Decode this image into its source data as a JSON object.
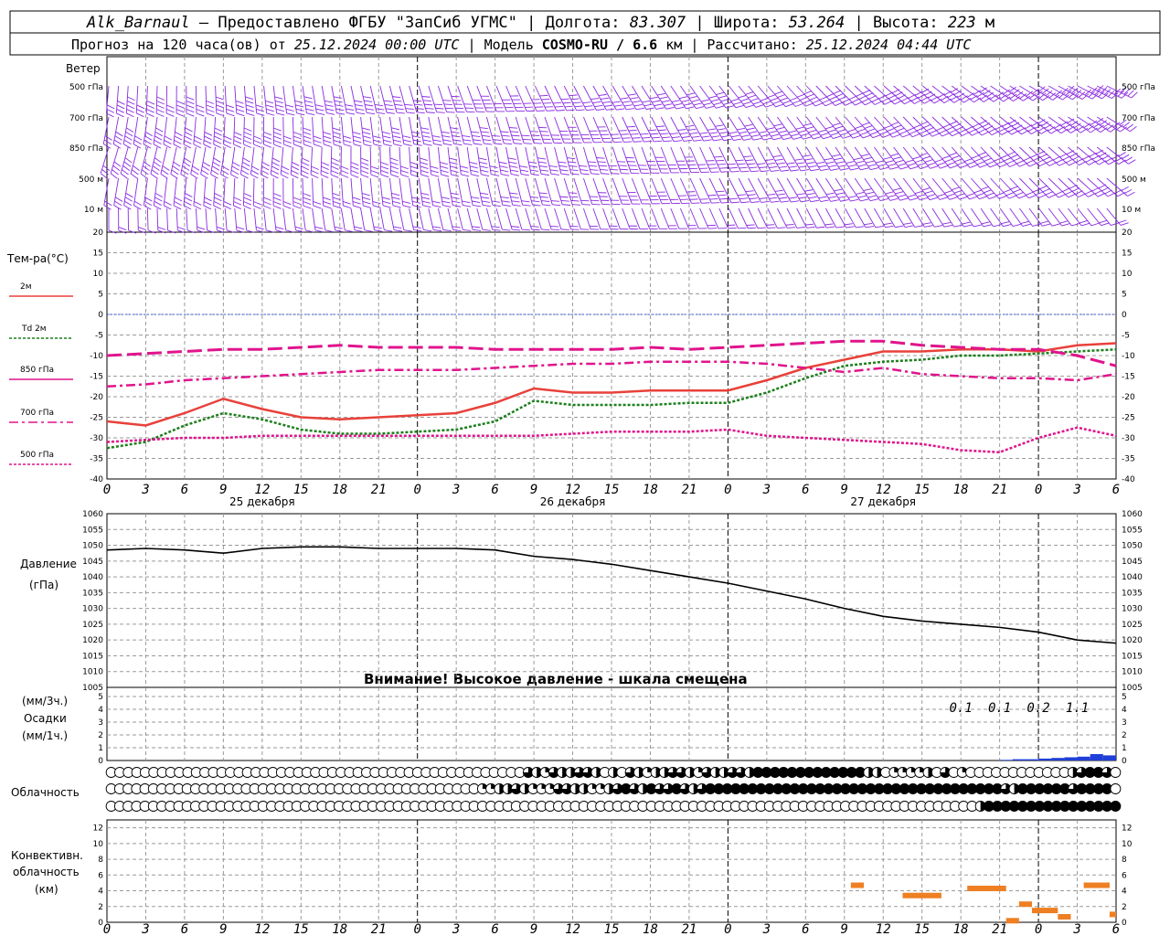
{
  "header": {
    "station": "Alk_Barnaul",
    "provider": "Предоставлено ФГБУ \"ЗапСиб УГМС\"",
    "lon_label": "Долгота:",
    "lon": "83.307",
    "lat_label": "Широта:",
    "lat": "53.264",
    "alt_label": "Высота:",
    "alt": "223",
    "alt_unit": "м",
    "forecast_label": "Прогноз на 120 часа(ов) от",
    "forecast_start": "25.12.2024 00:00 UTC",
    "model_label": "Модель",
    "model": "COSMO-RU / 6.6",
    "model_unit": "км",
    "computed_label": "Рассчитано:",
    "computed": "25.12.2024 04:44 UTC"
  },
  "x_axis": {
    "hour_ticks": [
      "0",
      "3",
      "6",
      "9",
      "12",
      "15",
      "18",
      "21",
      "0",
      "3",
      "6",
      "9",
      "12",
      "15",
      "18",
      "21",
      "0",
      "3",
      "6",
      "9",
      "12",
      "15",
      "18",
      "21",
      "0",
      "3",
      "6"
    ],
    "day_labels": [
      "25 декабря",
      "26 декабря",
      "27 декабря"
    ]
  },
  "panels": {
    "wind": {
      "title": "Ветер",
      "levels": [
        "500 гПа",
        "700 гПа",
        "850 гПа",
        "500 м",
        "10  м"
      ],
      "color": "#8a2be2"
    },
    "temperature": {
      "title": "Тем-ра(°C)",
      "ylim": [
        -40,
        20
      ],
      "ticks": [
        "20",
        "15",
        "10",
        "5",
        "0",
        "-5",
        "-10",
        "-15",
        "-20",
        "-25",
        "-30",
        "-35",
        "-40"
      ],
      "legend": [
        {
          "name": "2м",
          "color": "#e8413a",
          "style": "solid"
        },
        {
          "name": "Td  2м",
          "color": "#1b7f1b",
          "style": "dotted"
        },
        {
          "name": "850 гПа",
          "color": "#e0148c",
          "style": "solid"
        },
        {
          "name": "700 гПа",
          "color": "#e0148c",
          "style": "dashdot"
        },
        {
          "name": "500 гПа",
          "color": "#e0148c",
          "style": "dotted"
        }
      ]
    },
    "pressure": {
      "title": "Давление",
      "unit": "(гПа)",
      "ylim": [
        1005,
        1060
      ],
      "ticks": [
        "1060",
        "1055",
        "1050",
        "1045",
        "1040",
        "1035",
        "1030",
        "1025",
        "1020",
        "1015",
        "1010",
        "1005"
      ],
      "warning": "Внимание! Высокое давление - шкала смещена"
    },
    "precip": {
      "unit3": "(мм/3ч.)",
      "title": "Осадки",
      "unit1": "(мм/1ч.)",
      "ticks": [
        "5",
        "4",
        "3",
        "2",
        "1",
        "0"
      ],
      "sums": [
        "0.1",
        "0.1",
        "0.2",
        "1.1"
      ],
      "color": "#1f3fd6"
    },
    "cloud": {
      "title": "Облачность"
    },
    "convective": {
      "title1": "Конвективн.",
      "title2": "облачность",
      "unit": "(км)",
      "ticks": [
        "12",
        "10",
        "8",
        "6",
        "4",
        "2",
        "0"
      ],
      "color": "#ee7f22"
    }
  },
  "chart_data": {
    "type": "line",
    "x_hours": [
      0,
      3,
      6,
      9,
      12,
      15,
      18,
      21,
      24,
      27,
      30,
      33,
      36,
      39,
      42,
      45,
      48,
      51,
      54,
      57,
      60,
      63,
      66,
      69,
      72,
      75,
      78
    ],
    "series": [
      {
        "name": "2м",
        "values": [
          -26,
          -27,
          -24,
          -20.5,
          -23,
          -25,
          -25.5,
          -25,
          -24.5,
          -24,
          -21.5,
          -18,
          -19,
          -19,
          -18.5,
          -18.5,
          -18.5,
          -16,
          -13,
          -11,
          -9,
          -9,
          -8.5,
          -8.5,
          -9,
          -7.5,
          -7
        ]
      },
      {
        "name": "Td  2м",
        "values": [
          -32.5,
          -31,
          -27,
          -24,
          -25.5,
          -28,
          -29,
          -29,
          -28.5,
          -28,
          -26,
          -21,
          -22,
          -22,
          -22,
          -21.5,
          -21.5,
          -19,
          -15.5,
          -12.5,
          -11.5,
          -11,
          -10,
          -10,
          -9.5,
          -9,
          -8.5
        ]
      },
      {
        "name": "850 гПа",
        "values": [
          -10,
          -9.5,
          -9,
          -8.5,
          -8.5,
          -8,
          -7.5,
          -8,
          -8,
          -8,
          -8.5,
          -8.5,
          -8.5,
          -8.5,
          -8,
          -8.5,
          -8,
          -7.5,
          -7,
          -6.5,
          -6.5,
          -7.5,
          -8,
          -8.5,
          -8.5,
          -10,
          -12.5
        ]
      },
      {
        "name": "700 гПа",
        "values": [
          -17.5,
          -17,
          -16,
          -15.5,
          -15,
          -14.5,
          -14,
          -13.5,
          -13.5,
          -13.5,
          -13,
          -12.5,
          -12,
          -12,
          -11.5,
          -11.5,
          -11.5,
          -12,
          -13,
          -14,
          -13,
          -14.5,
          -15,
          -15.5,
          -15.5,
          -16,
          -14.5
        ]
      },
      {
        "name": "500 гПа",
        "values": [
          -31,
          -30.5,
          -30,
          -30,
          -29.5,
          -29.5,
          -29.5,
          -29.5,
          -29.5,
          -29.5,
          -29.5,
          -29.5,
          -29,
          -28.5,
          -28.5,
          -28.5,
          -28,
          -29.5,
          -30,
          -30.5,
          -31,
          -31.5,
          -33,
          -33.5,
          -30,
          -27.5,
          -29.5
        ]
      },
      {
        "name": "Давление",
        "values": [
          1048.5,
          1049,
          1048.5,
          1047.5,
          1049,
          1049.5,
          1049.5,
          1049,
          1049,
          1049,
          1048.5,
          1046.5,
          1045.5,
          1044,
          1042,
          1040,
          1038,
          1035.5,
          1033,
          1030,
          1027.5,
          1026,
          1025,
          1024,
          1022.5,
          1020,
          1019
        ]
      }
    ],
    "precip_bars": [
      {
        "x": 70,
        "value": 0.05
      },
      {
        "x": 71,
        "value": 0.1
      },
      {
        "x": 72,
        "value": 0.1
      },
      {
        "x": 73,
        "value": 0.15
      },
      {
        "x": 74,
        "value": 0.2
      },
      {
        "x": 75,
        "value": 0.25
      },
      {
        "x": 76,
        "value": 0.3
      },
      {
        "x": 77,
        "value": 0.5
      },
      {
        "x": 78,
        "value": 0.4
      }
    ],
    "cloud_rows": [
      {
        "name": "upper",
        "values": [
          0,
          0,
          0,
          0,
          0,
          0,
          0,
          0,
          0,
          0,
          0,
          0,
          0,
          0,
          0,
          0,
          0,
          0,
          0,
          0,
          0,
          0,
          0,
          0,
          0,
          0,
          0,
          0,
          0,
          0,
          0,
          0,
          0,
          0,
          0,
          0,
          0,
          0,
          0,
          0,
          0,
          0,
          0,
          0,
          0,
          0,
          0,
          0,
          0,
          3,
          2,
          1,
          3,
          2,
          2,
          3,
          3,
          2,
          0,
          2,
          0,
          3,
          2,
          1,
          2,
          2,
          3,
          3,
          2,
          1,
          3,
          2,
          2,
          3,
          3,
          2,
          4,
          4,
          4,
          4,
          4,
          4,
          4,
          4,
          4,
          4,
          4,
          4,
          4,
          2,
          2,
          0,
          1,
          1,
          1,
          1,
          2,
          0,
          3,
          0,
          1,
          0,
          0,
          0,
          0,
          0,
          0,
          0,
          0,
          0,
          0,
          0,
          0,
          2,
          3,
          4,
          4,
          3,
          0
        ]
      },
      {
        "name": "middle",
        "values": [
          0,
          0,
          0,
          0,
          0,
          0,
          0,
          0,
          0,
          0,
          0,
          0,
          0,
          0,
          0,
          0,
          0,
          0,
          0,
          0,
          0,
          0,
          0,
          0,
          0,
          0,
          0,
          0,
          0,
          0,
          0,
          0,
          0,
          0,
          0,
          0,
          0,
          0,
          0,
          0,
          0,
          0,
          0,
          0,
          1,
          1,
          2,
          2,
          3,
          2,
          1,
          1,
          1,
          3,
          3,
          2,
          2,
          1,
          1,
          2,
          3,
          4,
          3,
          2,
          4,
          3,
          3,
          4,
          3,
          2,
          3,
          4,
          4,
          4,
          4,
          4,
          4,
          4,
          4,
          4,
          4,
          4,
          4,
          4,
          4,
          4,
          4,
          4,
          4,
          4,
          4,
          4,
          4,
          4,
          4,
          4,
          4,
          4,
          4,
          4,
          4,
          4,
          4,
          4,
          4,
          4,
          3,
          2,
          4,
          4,
          4,
          4,
          4,
          4,
          3,
          4,
          4,
          4,
          4,
          0
        ]
      },
      {
        "name": "lower",
        "values": [
          0,
          0,
          0,
          0,
          0,
          0,
          0,
          0,
          0,
          0,
          0,
          0,
          0,
          0,
          0,
          0,
          0,
          0,
          0,
          0,
          0,
          0,
          0,
          0,
          0,
          0,
          0,
          0,
          0,
          0,
          0,
          0,
          0,
          0,
          0,
          0,
          0,
          0,
          0,
          0,
          0,
          0,
          0,
          0,
          0,
          0,
          0,
          0,
          0,
          0,
          0,
          0,
          0,
          0,
          0,
          0,
          0,
          0,
          0,
          0,
          0,
          0,
          0,
          0,
          0,
          0,
          0,
          0,
          0,
          0,
          0,
          0,
          0,
          0,
          0,
          0,
          0,
          0,
          0,
          0,
          0,
          0,
          0,
          0,
          0,
          0,
          0,
          0,
          0,
          0,
          0,
          0,
          0,
          0,
          0,
          0,
          0,
          0,
          0,
          0,
          0,
          0,
          0,
          2,
          4,
          4,
          4,
          4,
          4,
          4,
          4,
          4,
          4,
          4,
          4,
          4,
          4,
          4,
          4,
          4
        ]
      }
    ],
    "convective_bars": [
      {
        "x0": 57.5,
        "x1": 58.5,
        "value": 4.7
      },
      {
        "x0": 61.5,
        "x1": 64.5,
        "value": 3.4
      },
      {
        "x0": 66.5,
        "x1": 69.5,
        "value": 4.3
      },
      {
        "x0": 69.5,
        "x1": 70.5,
        "value": 0.2
      },
      {
        "x0": 70.5,
        "x1": 71.5,
        "value": 2.3
      },
      {
        "x0": 71.5,
        "x1": 73.5,
        "value": 1.5
      },
      {
        "x0": 73.5,
        "x1": 74.5,
        "value": 0.7
      },
      {
        "x0": 75.5,
        "x1": 77.5,
        "value": 4.7
      },
      {
        "x0": 77.5,
        "x1": 78,
        "value": 1.0
      }
    ]
  }
}
